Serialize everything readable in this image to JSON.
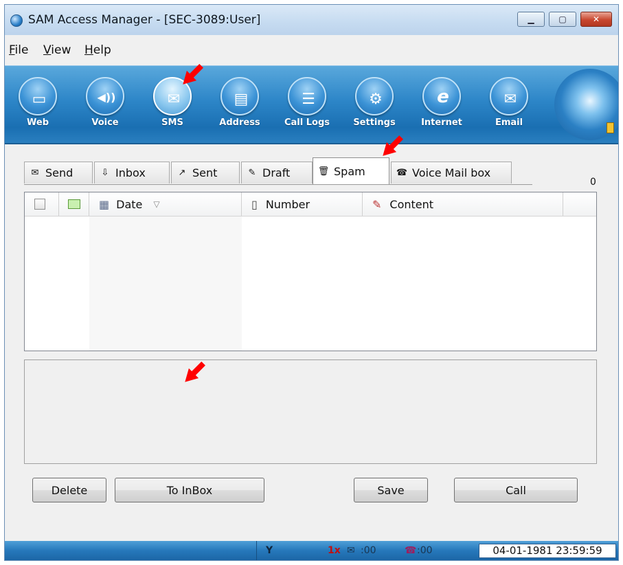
{
  "window": {
    "title": "SAM Access Manager - [SEC-3089:User]"
  },
  "window_buttons": {
    "minimize": "▁",
    "maximize": "▢",
    "close": "✕"
  },
  "menu": [
    {
      "label_pre": "",
      "label_key": "F",
      "label_post": "ile"
    },
    {
      "label_pre": "",
      "label_key": "V",
      "label_post": "iew"
    },
    {
      "label_pre": "",
      "label_key": "H",
      "label_post": "elp"
    }
  ],
  "toolbar": {
    "buttons": [
      {
        "label": "Web",
        "glyph": "▭",
        "icon": "web-icon"
      },
      {
        "label": "Voice",
        "glyph": "◀))",
        "icon": "speaker-icon"
      },
      {
        "label": "SMS",
        "glyph": "✉",
        "icon": "envelope-icon"
      },
      {
        "label": "Address",
        "glyph": "▤",
        "icon": "address-book-icon"
      },
      {
        "label": "Call Logs",
        "glyph": "☰",
        "icon": "call-logs-icon"
      },
      {
        "label": "Settings",
        "glyph": "⚙",
        "icon": "gear-icon"
      },
      {
        "label": "Internet",
        "glyph": "e",
        "icon": "internet-explorer-icon"
      },
      {
        "label": "Email",
        "glyph": "✉",
        "icon": "email-icon"
      }
    ],
    "active": "SMS"
  },
  "tabs": [
    {
      "label": "Send",
      "glyph": "✉"
    },
    {
      "label": "Inbox",
      "glyph": "⇩"
    },
    {
      "label": "Sent",
      "glyph": "↗"
    },
    {
      "label": "Draft",
      "glyph": "✎"
    },
    {
      "label": "Spam",
      "glyph": "🗑"
    },
    {
      "label": "Voice Mail box",
      "glyph": "☎"
    }
  ],
  "active_tab": "Spam",
  "message_count": "0",
  "columns": [
    {
      "label": "Date",
      "sort_glyph": "▽",
      "glyph": "▦"
    },
    {
      "label": "Number",
      "glyph": "▯"
    },
    {
      "label": "Content",
      "glyph": "✎"
    }
  ],
  "rows": [],
  "actions": {
    "delete": "Delete",
    "to_inbox": "To InBox",
    "save": "Save",
    "call": "Call"
  },
  "status": {
    "signal": "Y",
    "network": "1x",
    "sms_count": ":00",
    "call_count": ":00",
    "datetime": "04-01-1981 23:59:59"
  },
  "colors": {
    "toolbar_blue": "#2d86c8",
    "annotation_arrow": "#ff0000"
  }
}
